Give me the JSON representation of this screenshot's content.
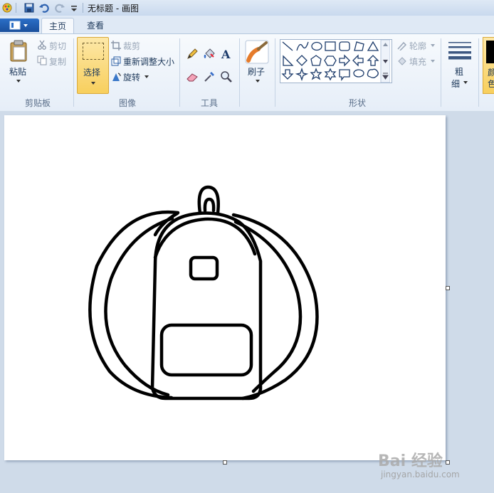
{
  "window": {
    "title": "无标题 - 画图"
  },
  "tabs": [
    {
      "label": "主页"
    },
    {
      "label": "查看"
    }
  ],
  "clipboard": {
    "paste": "粘贴",
    "cut": "剪切",
    "copy": "复制",
    "group": "剪贴板"
  },
  "image": {
    "select": "选择",
    "crop": "裁剪",
    "resize": "重新调整大小",
    "rotate": "旋转",
    "group": "图像"
  },
  "tools": {
    "group": "工具"
  },
  "brushes": {
    "label": "刷子"
  },
  "shapes": {
    "outline": "轮廓",
    "fill": "填充",
    "group": "形状"
  },
  "size": {
    "label_top": "粗",
    "label_bottom": "细"
  },
  "colors": {
    "label_partial": "颜",
    "label_partial2": "色"
  },
  "watermark": {
    "text": "Bai 经验",
    "url": "jingyan.baidu.com"
  },
  "accent": {
    "file_button": "#1a4f9c",
    "select_active": "#f8cf5d",
    "color_swatch": "#000000"
  }
}
